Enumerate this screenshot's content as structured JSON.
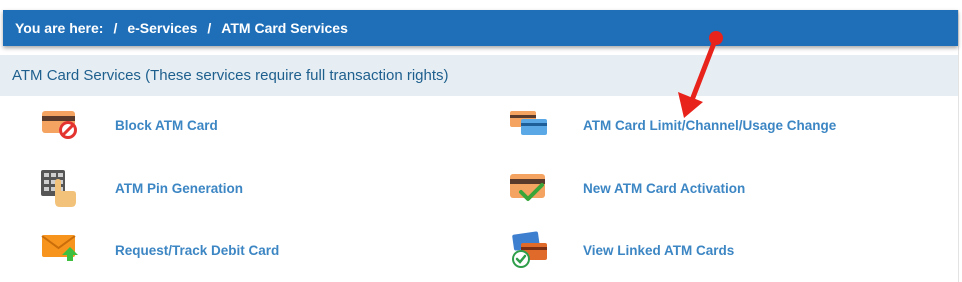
{
  "breadcrumb": {
    "prefix": "You are here:",
    "sep": "/",
    "items": [
      "e-Services",
      "ATM Card Services"
    ]
  },
  "section": {
    "title": "ATM Card Services (These services require full transaction rights)"
  },
  "services": [
    {
      "label": "Block ATM Card",
      "icon": "atm-card-block-icon"
    },
    {
      "label": "ATM Card Limit/Channel/Usage Change",
      "icon": "cards-limit-icon"
    },
    {
      "label": "ATM Pin Generation",
      "icon": "keypad-hand-icon"
    },
    {
      "label": "New ATM Card Activation",
      "icon": "card-check-icon"
    },
    {
      "label": "Request/Track Debit Card",
      "icon": "envelope-upload-icon"
    },
    {
      "label": "View Linked ATM Cards",
      "icon": "linked-cards-icon"
    }
  ],
  "colors": {
    "header_blue": "#1f6fb8",
    "section_bg": "#e6eef3",
    "link_blue": "#3c86c4",
    "annotation_red": "#e8231b"
  }
}
